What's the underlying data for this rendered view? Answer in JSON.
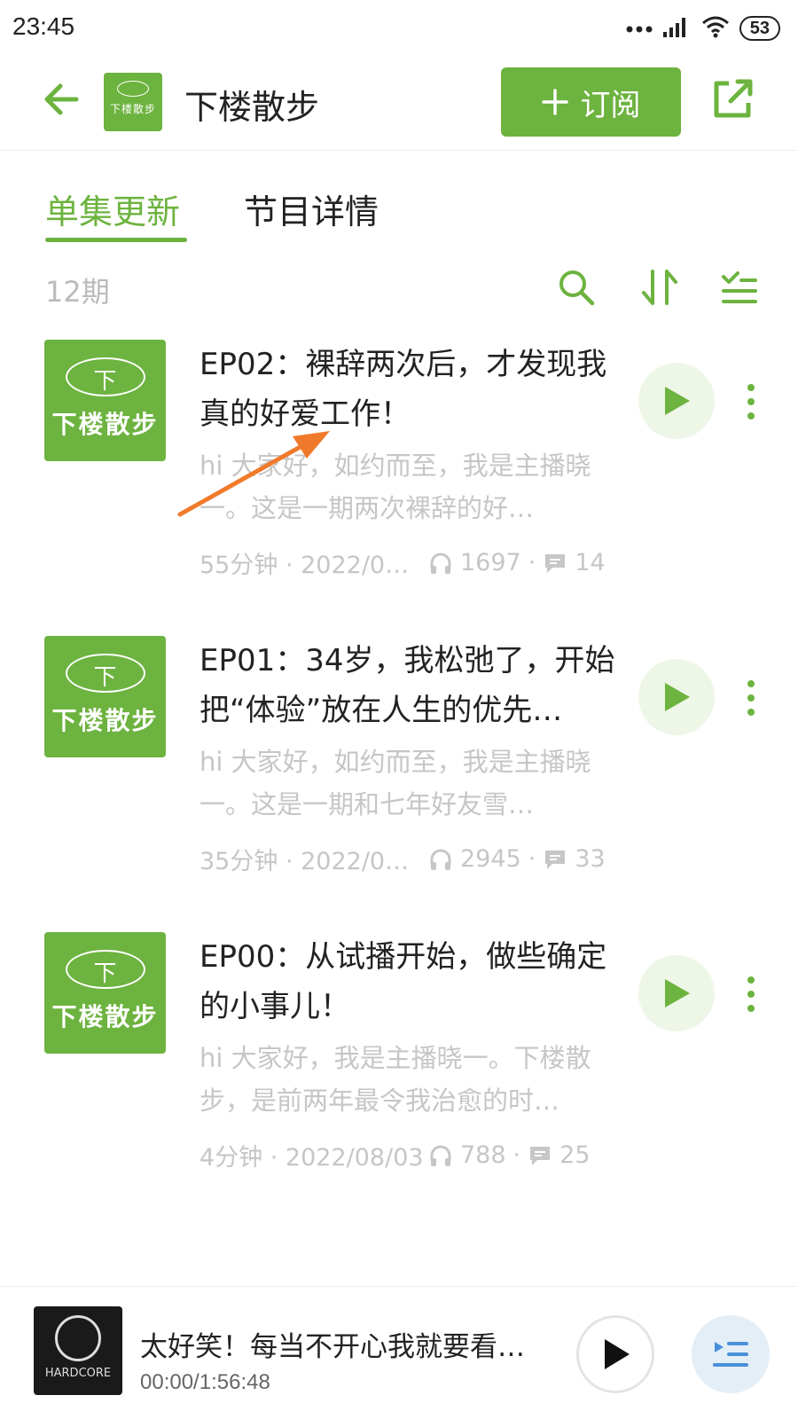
{
  "status_bar": {
    "time": "23:45",
    "battery": "53"
  },
  "header": {
    "title": "下楼散步",
    "logo_text": "下楼散步",
    "subscribe_label": "订阅"
  },
  "tabs": [
    {
      "label": "单集更新",
      "active": true
    },
    {
      "label": "节目详情",
      "active": false
    }
  ],
  "toolbar": {
    "episode_count": "12期"
  },
  "episodes": [
    {
      "cover_text": "下楼散步",
      "cover_glyph": "下",
      "title": "EP02：裸辞两次后，才发现我真的好爱工作！",
      "description": "hi 大家好，如约而至，我是主播晓一。这是一期两次裸辞的好…",
      "duration": "55分钟 · 2022/0…",
      "plays": "1697",
      "comments": "14"
    },
    {
      "cover_text": "下楼散步",
      "cover_glyph": "下",
      "title": "EP01：34岁，我松弛了，开始把“体验”放在人生的优先…",
      "description": "hi 大家好，如约而至，我是主播晓一。这是一期和七年好友雪…",
      "duration": "35分钟 · 2022/0…",
      "plays": "2945",
      "comments": "33"
    },
    {
      "cover_text": "下楼散步",
      "cover_glyph": "下",
      "title": "EP00：从试播开始，做些确定的小事儿！",
      "description": "hi 大家好，我是主播晓一。下楼散步，是前两年最令我治愈的时…",
      "duration": "4分钟 · 2022/08/03",
      "plays": "788",
      "comments": "25"
    }
  ],
  "mini_player": {
    "title": "太好笑！每当不开心我就要看…",
    "time": "00:00/1:56:48",
    "cover_text": "HARDCORE"
  },
  "colors": {
    "accent": "#6db33f",
    "annotation": "#f07a2c"
  }
}
